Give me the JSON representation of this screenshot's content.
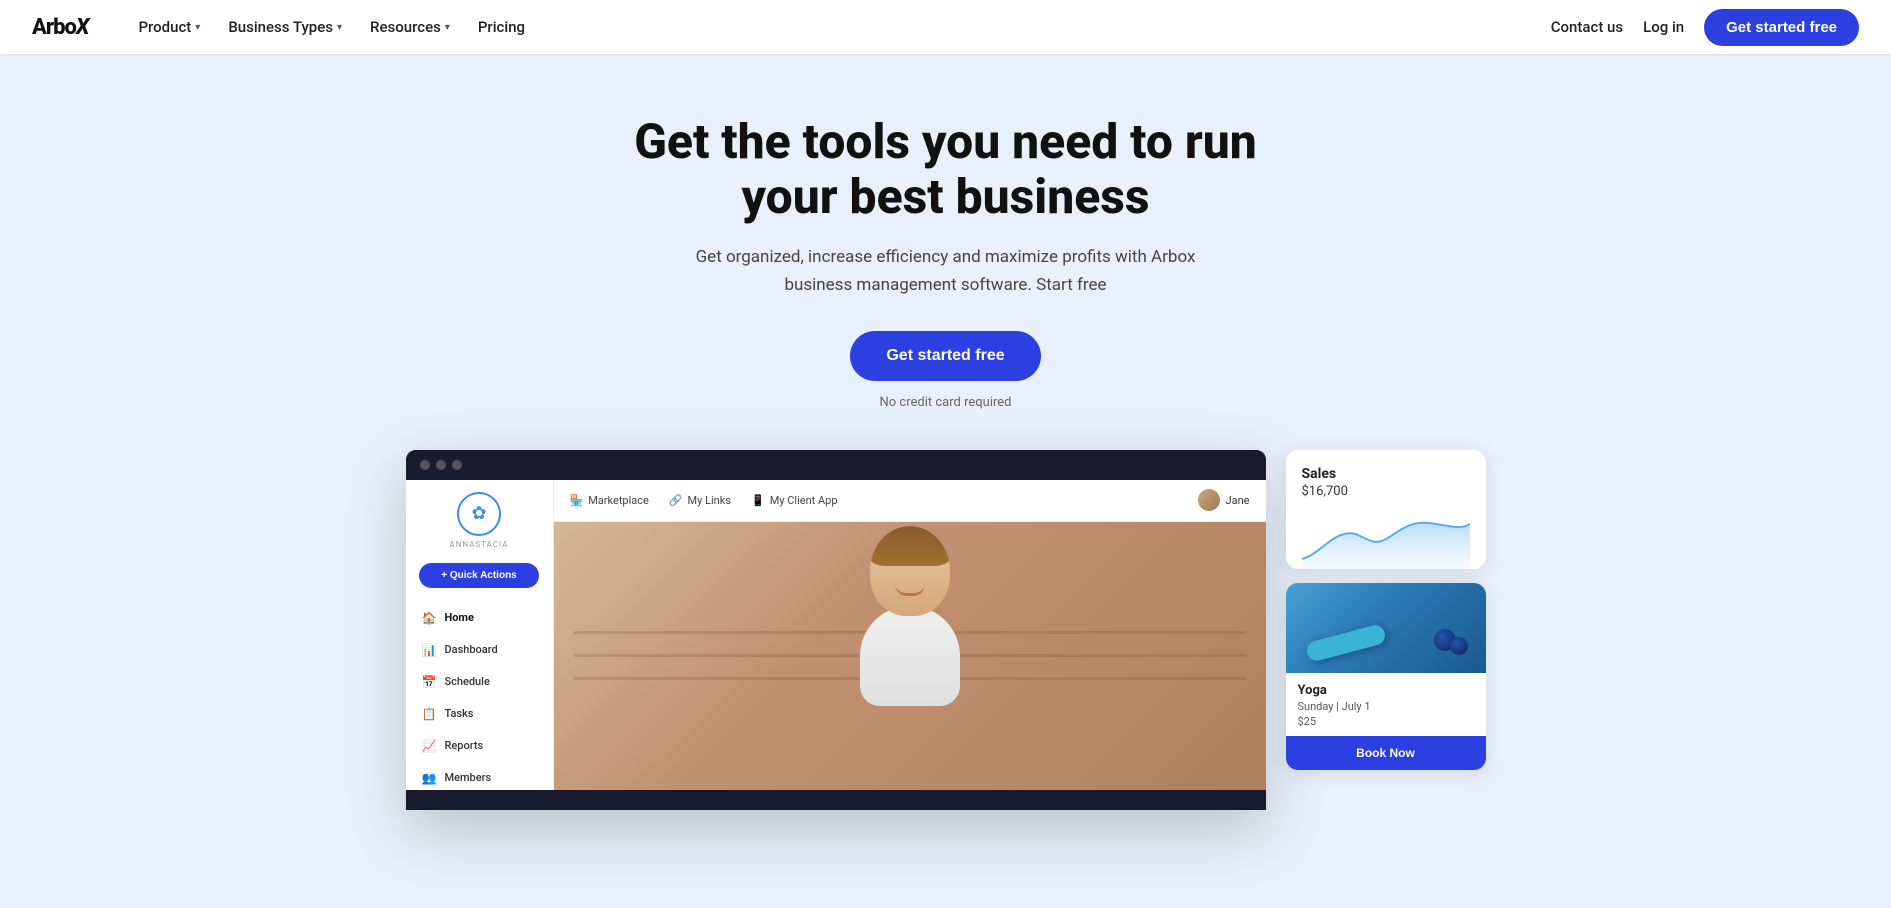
{
  "navbar": {
    "logo": "ArboX",
    "nav_items": [
      {
        "id": "product",
        "label": "Product",
        "has_dropdown": true
      },
      {
        "id": "business_types",
        "label": "Business Types",
        "has_dropdown": true
      },
      {
        "id": "resources",
        "label": "Resources",
        "has_dropdown": true
      },
      {
        "id": "pricing",
        "label": "Pricing",
        "has_dropdown": false
      }
    ],
    "contact_us": "Contact us",
    "log_in": "Log in",
    "get_started": "Get started free"
  },
  "hero": {
    "title": "Get the tools you need to run your best business",
    "subtitle": "Get organized, increase efficiency and maximize profits with Arbox business management software. Start free",
    "cta_button": "Get started free",
    "no_cc": "No credit card required"
  },
  "app_demo": {
    "browser_dots": [
      "dot1",
      "dot2",
      "dot3"
    ],
    "topbar": {
      "items": [
        {
          "icon": "🏪",
          "label": "Marketplace"
        },
        {
          "icon": "🔗",
          "label": "My Links"
        },
        {
          "icon": "📱",
          "label": "My Client App"
        }
      ],
      "user_name": "Jane"
    },
    "sidebar": {
      "brand_name": "ANNASTACIA",
      "quick_actions": "+ Quick Actions",
      "nav_items": [
        {
          "id": "home",
          "icon": "🏠",
          "label": "Home",
          "active": true
        },
        {
          "id": "dashboard",
          "icon": "📊",
          "label": "Dashboard",
          "active": false
        },
        {
          "id": "schedule",
          "icon": "📅",
          "label": "Schedule",
          "active": false
        },
        {
          "id": "tasks",
          "icon": "📋",
          "label": "Tasks",
          "active": false
        },
        {
          "id": "reports",
          "icon": "📈",
          "label": "Reports",
          "active": false
        },
        {
          "id": "members",
          "icon": "👥",
          "label": "Members",
          "active": false
        }
      ]
    }
  },
  "sales_card": {
    "label": "Sales",
    "amount": "$16,700"
  },
  "yoga_card": {
    "title": "Yoga",
    "date": "Sunday | July 1",
    "price": "$25",
    "book_now": "Book Now"
  }
}
